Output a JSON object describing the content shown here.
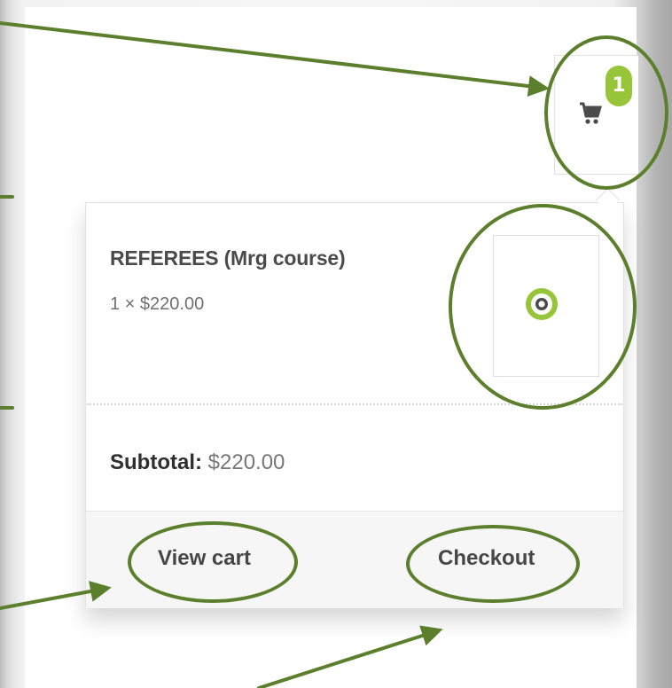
{
  "mini_cart": {
    "badge_count": "1",
    "item": {
      "name": "REFEREES (Mrg course)",
      "quantity_price": "1 × $220.00"
    },
    "subtotal_label": "Subtotal:",
    "subtotal_value": " $220.00",
    "view_cart_label": "View cart",
    "checkout_label": "Checkout"
  },
  "icons": {
    "cart": "cart-icon",
    "product_logo": "logo-ring-icon"
  },
  "colors": {
    "accent_green": "#97c53a",
    "annotation_green": "#5b7f2c",
    "text_dark": "#4a4a4a"
  }
}
